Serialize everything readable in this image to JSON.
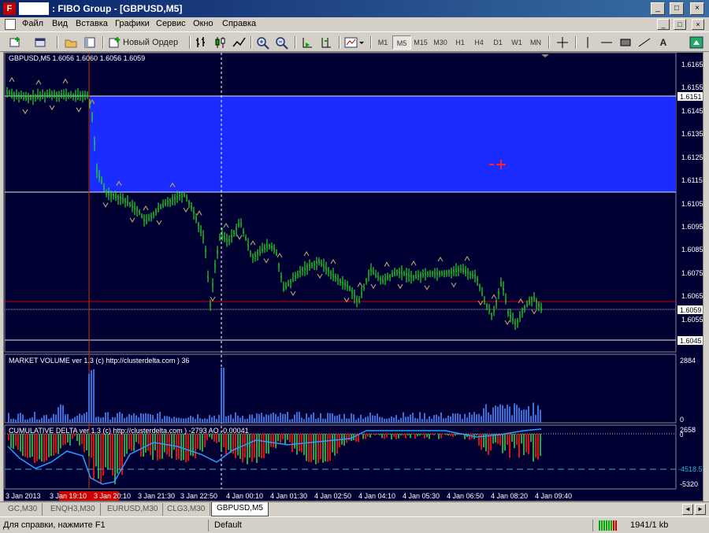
{
  "window": {
    "title": ": FIBO Group - [GBPUSD,M5]",
    "minimize_glyph": "_",
    "maximize_glyph": "□",
    "close_glyph": "×"
  },
  "menu": {
    "items": [
      "Файл",
      "Вид",
      "Вставка",
      "Графики",
      "Сервис",
      "Окно",
      "Справка"
    ]
  },
  "toolbar": {
    "new_order_label": "Новый Ордер",
    "timeframes": [
      "M1",
      "M5",
      "M15",
      "M30",
      "H1",
      "H4",
      "D1",
      "W1",
      "MN"
    ],
    "active_timeframe": "M5",
    "text_tool": "A"
  },
  "chart": {
    "header": "GBPUSD,M5  1.6056 1.6060 1.6056 1.6059",
    "colors": {
      "background": "#000033",
      "bull": "#22dd22",
      "zone": "#1a2cff",
      "level_line": "#cc0000",
      "fractal": "#b59a6a"
    },
    "price_ticks": [
      "1.6165",
      "1.6155",
      "1.6145",
      "1.6135",
      "1.6125",
      "1.6115",
      "1.6105",
      "1.6095",
      "1.6085",
      "1.6075",
      "1.6065",
      "1.6055"
    ],
    "price_labels": {
      "upper_level": "1.6151",
      "current": "1.6059",
      "lower_level": "1.6045"
    },
    "volume_header": "MARKET VOLUME ver 1.3 (c) http://clusterdelta.com ) 36",
    "volume_ticks": [
      "2884",
      "0"
    ],
    "delta_header": "CUMULATIVE DELTA ver 1.3 (c) http://clusterdelta.com ) -2793  AO -0.00041",
    "delta_ticks": [
      "2658",
      "0",
      "-4518.53",
      "-5320"
    ],
    "time_labels": [
      "3 Jan 2013",
      "3 Jan 19:10",
      "3 Jan 20:10",
      "3 Jan 21:30",
      "3 Jan 22:50",
      "4 Jan 00:10",
      "4 Jan 01:30",
      "4 Jan 02:50",
      "4 Jan 04:10",
      "4 Jan 05:30",
      "4 Jan 06:50",
      "4 Jan 08:20",
      "4 Jan 09:40"
    ]
  },
  "tabs": [
    "GC,M30",
    "ENQH3,M30",
    "EURUSD,M30",
    "CLG3,M30",
    "GBPUSD,M5"
  ],
  "active_tab": "GBPUSD,M5",
  "status": {
    "help": "Для справки, нажмите F1",
    "profile": "Default",
    "traffic": "1941/1 kb"
  }
}
